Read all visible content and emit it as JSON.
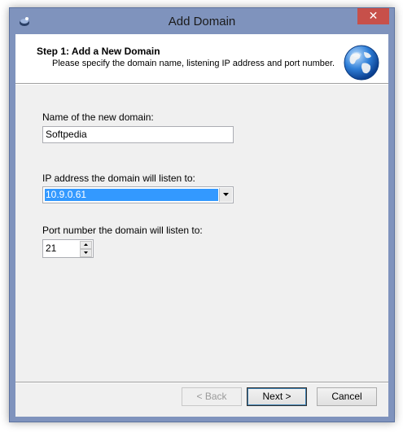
{
  "window": {
    "title": "Add Domain",
    "close_glyph": "✕"
  },
  "header": {
    "step_title": "Step 1: Add a New Domain",
    "step_description": "Please specify the domain name, listening IP address and port number.",
    "icon": "globe-icon"
  },
  "form": {
    "domain_label": "Name of the new domain:",
    "domain_value": "Softpedia",
    "ip_label": "IP address the domain will listen to:",
    "ip_value": "10.9.0.61",
    "port_label": "Port number the domain will listen to:",
    "port_value": "21"
  },
  "buttons": {
    "back": "< Back",
    "next": "Next >",
    "cancel": "Cancel"
  },
  "colors": {
    "title_bar": "#7f93bd",
    "close_button": "#c7504a",
    "selection": "#3399ff",
    "dialog_bg": "#f0f0f0"
  }
}
